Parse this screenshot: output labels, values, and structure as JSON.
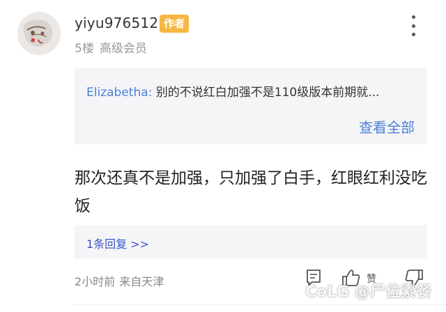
{
  "post": {
    "username": "yiyu976512",
    "author_badge": "作者",
    "floor": "5楼",
    "member_level": "高级会员"
  },
  "quote": {
    "author": "Elizabetha:",
    "text": "别的不说红白加强不是110级版本前期就...",
    "view_all": "查看全部"
  },
  "content": "那次还真不是加强，只加强了白手，红眼红利没吃饭",
  "replies": {
    "link": "1条回复 >>"
  },
  "footer": {
    "time": "2小时前",
    "location": "来自天津",
    "like_label": "赞"
  },
  "watermark": "CoLG @尸位素餐",
  "icons": {
    "more": "more-vertical-icon",
    "comment": "comment-icon",
    "like": "thumbs-up-icon",
    "dislike": "thumbs-down-icon"
  },
  "colors": {
    "badge": "#f6b742",
    "link_blue": "#4a7fd6",
    "reply_blue": "#3a55c8",
    "quote_bg": "#f5f5f7"
  }
}
